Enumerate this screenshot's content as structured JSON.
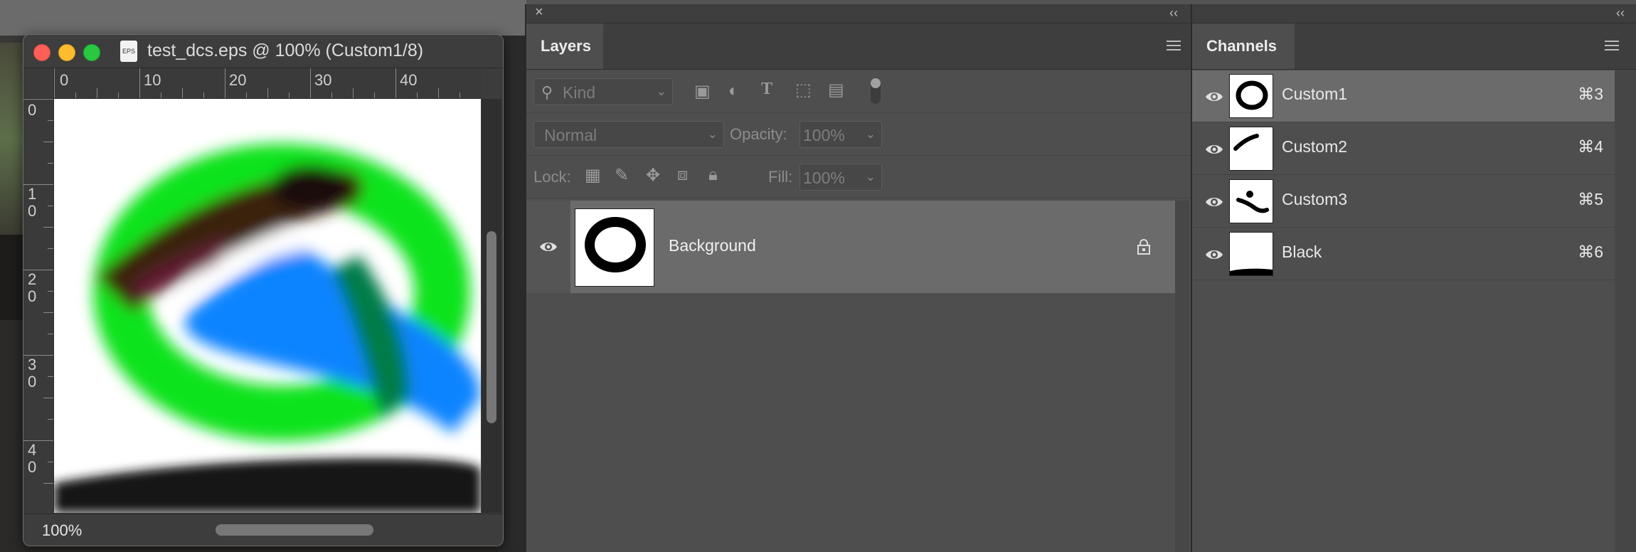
{
  "document": {
    "title": "test_dcs.eps @ 100% (Custom1/8)",
    "file_icon_label": "EPS",
    "zoom": "100%",
    "ruler_h_labels": [
      "0",
      "10",
      "20",
      "30",
      "40"
    ],
    "ruler_v_labels": [
      "0",
      "10",
      "20",
      "30",
      "40"
    ]
  },
  "layers_panel": {
    "tab_label": "Layers",
    "filter_kind": "Kind",
    "blend_mode": "Normal",
    "opacity_label": "Opacity:",
    "opacity_value": "100%",
    "lock_label": "Lock:",
    "fill_label": "Fill:",
    "fill_value": "100%",
    "layers": [
      {
        "name": "Background",
        "locked": true,
        "visible": true
      }
    ]
  },
  "channels_panel": {
    "tab_label": "Channels",
    "channels": [
      {
        "name": "Custom1",
        "shortcut": "⌘3",
        "selected": true
      },
      {
        "name": "Custom2",
        "shortcut": "⌘4",
        "selected": false
      },
      {
        "name": "Custom3",
        "shortcut": "⌘5",
        "selected": false
      },
      {
        "name": "Black",
        "shortcut": "⌘6",
        "selected": false
      }
    ]
  },
  "colors": {
    "canvas_green": "#10e31a",
    "canvas_blue": "#0a84ff",
    "canvas_dark_green": "#047b4a",
    "canvas_brown": "#3a2210",
    "panel_bg": "#4e4e4e",
    "selection_bg": "#6b6b6b"
  },
  "icons": {
    "close": "close-icon",
    "collapse": "double-chevron-icon",
    "panel_menu": "hamburger-menu-icon",
    "visibility": "eye-icon",
    "lock": "lock-icon"
  }
}
